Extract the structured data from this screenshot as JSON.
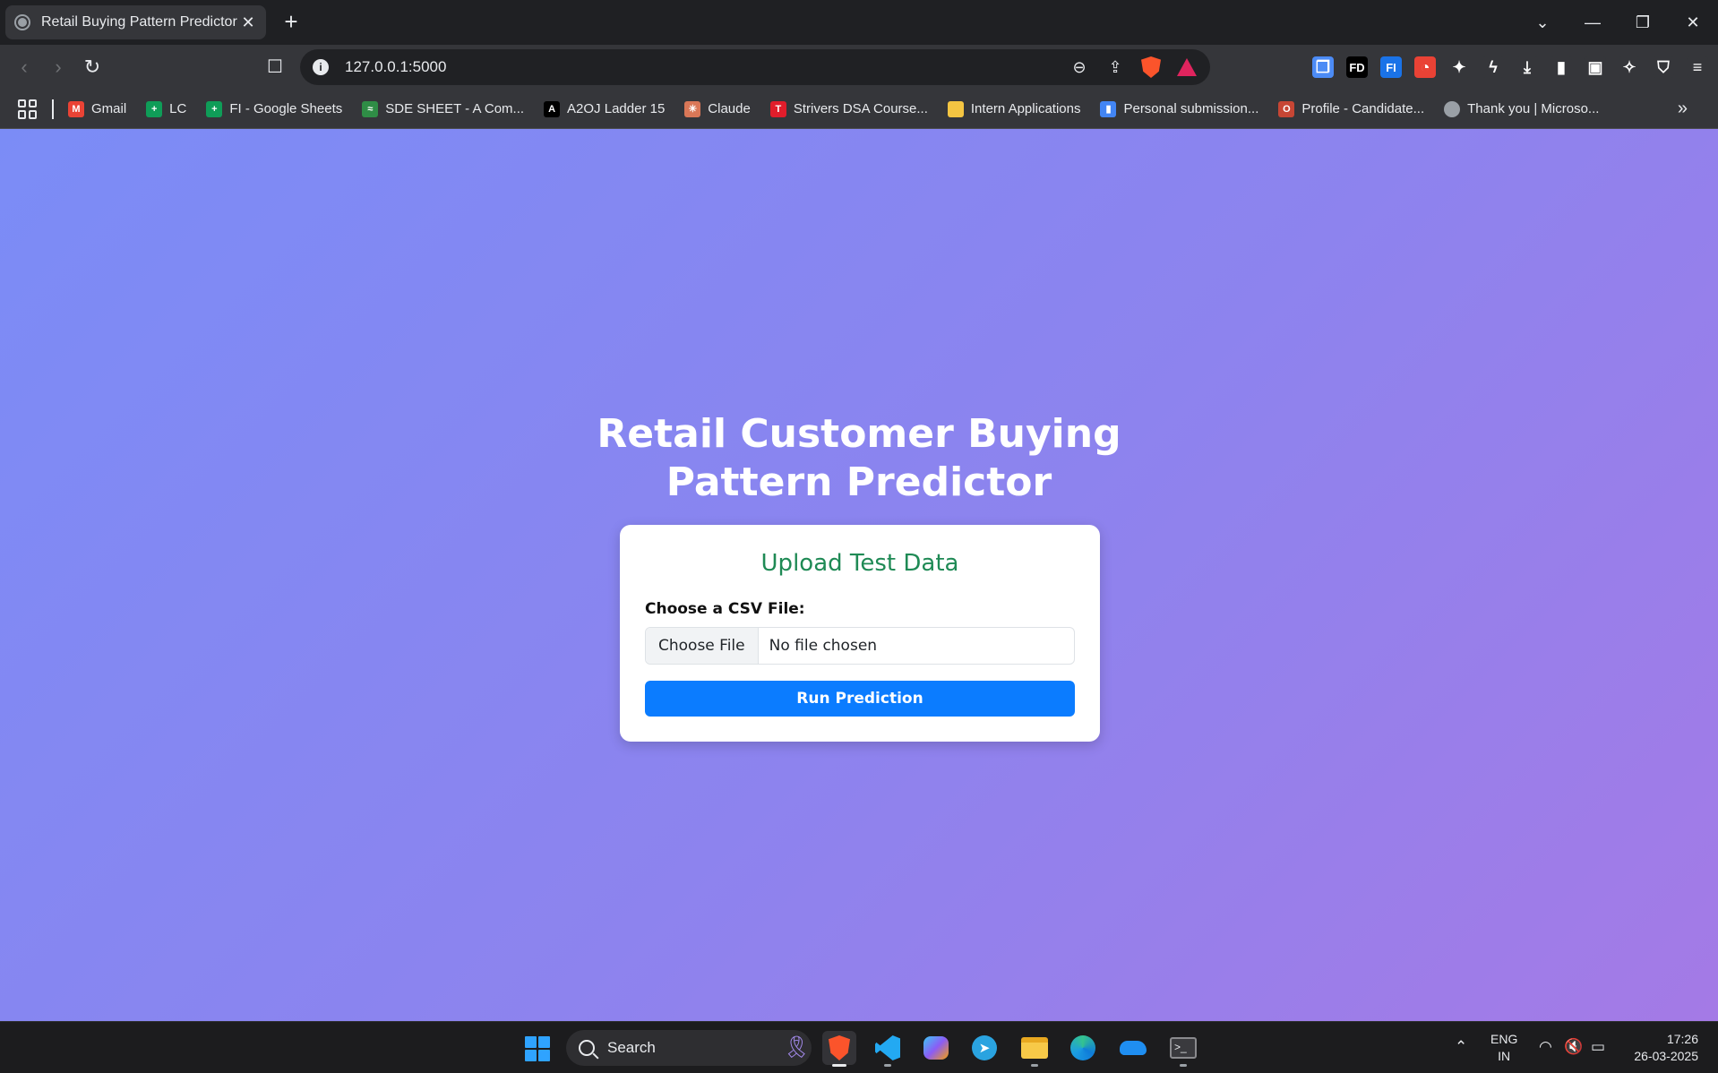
{
  "browser": {
    "tab": {
      "title": "Retail Buying Pattern Predictor"
    },
    "address": {
      "url": "127.0.0.1:5000"
    },
    "extensions": [
      {
        "name": "translate-ext-icon",
        "label": "",
        "color": "#4c8bf5"
      },
      {
        "name": "fd-ext-icon",
        "label": "FD",
        "color": "#000000"
      },
      {
        "name": "fi-ext-icon",
        "label": "FI",
        "color": "#1a73e8"
      },
      {
        "name": "color-ext-icon",
        "label": "",
        "color": "#e94235"
      },
      {
        "name": "puzzle-icon",
        "label": "",
        "color": "#35363a"
      },
      {
        "name": "bolt-ext-icon",
        "label": "",
        "color": "#35363a"
      },
      {
        "name": "download-icon",
        "label": "",
        "color": "#35363a"
      },
      {
        "name": "sidebar-icon",
        "label": "",
        "color": "#35363a"
      },
      {
        "name": "wallet-icon",
        "label": "",
        "color": "#35363a"
      },
      {
        "name": "leo-ai-icon",
        "label": "",
        "color": "#35363a"
      },
      {
        "name": "vpn-shield-icon",
        "label": "",
        "color": "#35363a"
      },
      {
        "name": "menu-icon",
        "label": "",
        "color": "#35363a"
      }
    ],
    "bookmarks": [
      {
        "label": "Gmail",
        "icon": "gmail-icon",
        "glyph": "M",
        "color": "#ea4335"
      },
      {
        "label": "LC",
        "icon": "sheets-icon",
        "glyph": "+",
        "color": "#0f9d58"
      },
      {
        "label": "FI - Google Sheets",
        "icon": "sheets-icon",
        "glyph": "+",
        "color": "#0f9d58"
      },
      {
        "label": "SDE SHEET - A Com...",
        "icon": "geeks-icon",
        "glyph": "≈",
        "color": "#2f8d46"
      },
      {
        "label": "A2OJ Ladder 15",
        "icon": "a2oj-icon",
        "glyph": "A",
        "color": "#000000"
      },
      {
        "label": "Claude",
        "icon": "claude-icon",
        "glyph": "✳",
        "color": "#d97757"
      },
      {
        "label": "Strivers DSA Course...",
        "icon": "tuf-icon",
        "glyph": "T",
        "color": "#e11d2b"
      },
      {
        "label": "Intern Applications",
        "icon": "folder-icon",
        "glyph": "",
        "color": "#f4c542"
      },
      {
        "label": "Personal submission...",
        "icon": "chart-icon",
        "glyph": "▮",
        "color": "#4285f4"
      },
      {
        "label": "Profile - Candidate...",
        "icon": "oracle-icon",
        "glyph": "O",
        "color": "#c74634"
      },
      {
        "label": "Thank you | Microso...",
        "icon": "globe-icon",
        "glyph": "",
        "color": "#9aa0a6"
      }
    ]
  },
  "page": {
    "title_line1": "Retail Customer Buying",
    "title_line2": "Pattern Predictor",
    "card": {
      "heading": "Upload Test Data",
      "field_label": "Choose a CSV File:",
      "file_button": "Choose File",
      "file_status": "No file chosen",
      "submit_label": "Run Prediction"
    },
    "colors": {
      "heading": "#1f8a55",
      "submit": "#0b7cff"
    }
  },
  "taskbar": {
    "search_label": "Search",
    "apps": [
      "brave-icon",
      "vscode-icon",
      "copilot-icon",
      "telegram-icon",
      "file-explorer-icon",
      "edge-icon",
      "onedrive-icon",
      "terminal-icon"
    ],
    "language": "ENG",
    "region": "IN",
    "time": "17:26",
    "date": "26-03-2025"
  }
}
